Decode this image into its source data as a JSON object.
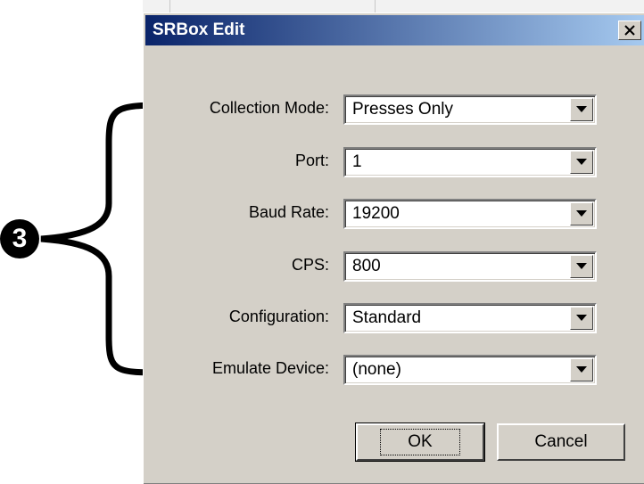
{
  "dialog": {
    "title": "SRBox Edit"
  },
  "annotation": {
    "marker_label": "3"
  },
  "fields": [
    {
      "label": "Collection Mode:",
      "value": "Presses Only"
    },
    {
      "label": "Port:",
      "value": "1"
    },
    {
      "label": "Baud Rate:",
      "value": "19200"
    },
    {
      "label": "CPS:",
      "value": "800"
    },
    {
      "label": "Configuration:",
      "value": "Standard"
    },
    {
      "label": "Emulate Device:",
      "value": "(none)"
    }
  ],
  "buttons": {
    "ok_label": "OK",
    "cancel_label": "Cancel"
  },
  "colors": {
    "titlebar_start": "#0a246a",
    "titlebar_end": "#a6caf0",
    "dialog_face": "#d4d0c8"
  },
  "icons": [
    "close-icon",
    "dropdown-arrow-icon"
  ]
}
